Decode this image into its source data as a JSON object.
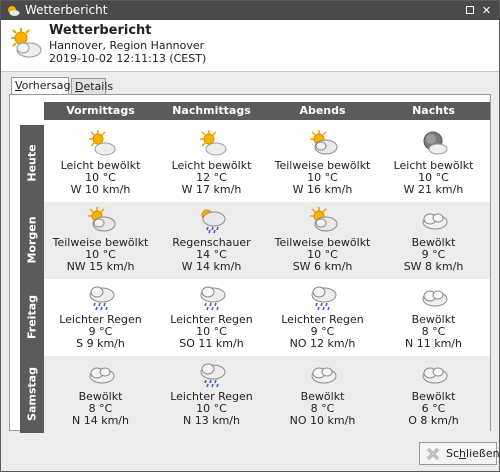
{
  "window": {
    "title": "Wetterbericht"
  },
  "header": {
    "title": "Wetterbericht",
    "location": "Hannover, Region Hannover",
    "timestamp": "2019-10-02 12:11:13 (CEST)"
  },
  "tabs": [
    {
      "label": "Vorhersage",
      "active": true
    },
    {
      "label": "Details",
      "active": false
    }
  ],
  "columns": [
    "Vormittags",
    "Nachmittags",
    "Abends",
    "Nachts"
  ],
  "rows": [
    {
      "label": "Heute",
      "cells": [
        {
          "icon": "sun-cloud-icon",
          "desc": "Leicht bewölkt",
          "temp": "10 °C",
          "wind": "W 10 km/h"
        },
        {
          "icon": "sun-cloud-icon",
          "desc": "Leicht bewölkt",
          "temp": "12 °C",
          "wind": "W 17 km/h"
        },
        {
          "icon": "partly-cloudy-icon",
          "desc": "Teilweise bewölkt",
          "temp": "10 °C",
          "wind": "W 16 km/h"
        },
        {
          "icon": "moon-cloud-icon",
          "desc": "Leicht bewölkt",
          "temp": "10 °C",
          "wind": "W 21 km/h"
        }
      ]
    },
    {
      "label": "Morgen",
      "cells": [
        {
          "icon": "partly-cloudy-icon",
          "desc": "Teilweise bewölkt",
          "temp": "10 °C",
          "wind": "NW 15 km/h"
        },
        {
          "icon": "sun-shower-icon",
          "desc": "Regenschauer",
          "temp": "14 °C",
          "wind": "W 14 km/h"
        },
        {
          "icon": "partly-cloudy-icon",
          "desc": "Teilweise bewölkt",
          "temp": "10 °C",
          "wind": "SW 6 km/h"
        },
        {
          "icon": "cloud-icon",
          "desc": "Bewölkt",
          "temp": "9 °C",
          "wind": "SW 8 km/h"
        }
      ]
    },
    {
      "label": "Freitag",
      "cells": [
        {
          "icon": "rain-icon",
          "desc": "Leichter Regen",
          "temp": "9 °C",
          "wind": "S 9 km/h"
        },
        {
          "icon": "rain-icon",
          "desc": "Leichter Regen",
          "temp": "10 °C",
          "wind": "SO 11 km/h"
        },
        {
          "icon": "rain-icon",
          "desc": "Leichter Regen",
          "temp": "9 °C",
          "wind": "NO 12 km/h"
        },
        {
          "icon": "cloud-icon",
          "desc": "Bewölkt",
          "temp": "8 °C",
          "wind": "N 11 km/h"
        }
      ]
    },
    {
      "label": "Samstag",
      "cells": [
        {
          "icon": "cloud-icon",
          "desc": "Bewölkt",
          "temp": "8 °C",
          "wind": "N 14 km/h"
        },
        {
          "icon": "rain-icon",
          "desc": "Leichter Regen",
          "temp": "10 °C",
          "wind": "N 13 km/h"
        },
        {
          "icon": "cloud-icon",
          "desc": "Bewölkt",
          "temp": "8 °C",
          "wind": "NO 10 km/h"
        },
        {
          "icon": "cloud-icon",
          "desc": "Bewölkt",
          "temp": "6 °C",
          "wind": "O 8 km/h"
        }
      ]
    }
  ],
  "footer": {
    "close_label": "Schließen"
  },
  "colors": {
    "titlebar": "#4a4a4a",
    "grid_header": "#5b5b5b",
    "row_shade": "#ececec"
  }
}
